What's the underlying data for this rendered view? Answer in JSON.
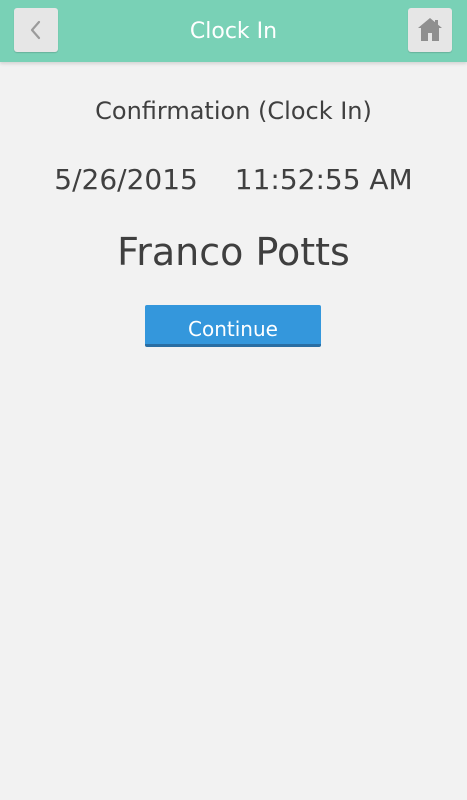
{
  "header": {
    "title": "Clock In",
    "back_icon": "chevron-left-icon",
    "home_icon": "home-icon",
    "color": "#79d1b6"
  },
  "confirmation": {
    "title": "Confirmation (Clock In)",
    "date": "5/26/2015",
    "time": "11:52:55 AM",
    "employee_name": "Franco Potts"
  },
  "actions": {
    "continue_label": "Continue",
    "continue_color": "#3497dc"
  }
}
